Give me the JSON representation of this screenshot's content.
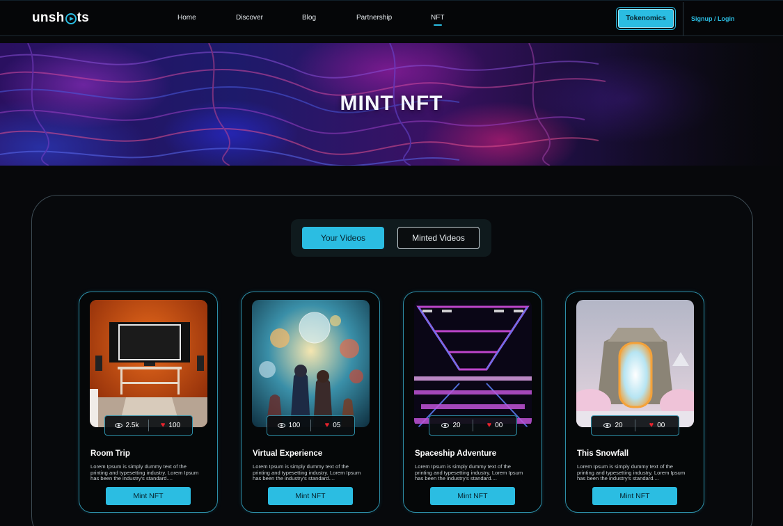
{
  "nav": {
    "logo": {
      "before": "unsh",
      "after": "ts"
    },
    "links": [
      "Home",
      "Discover",
      "Blog",
      "Partnership",
      "NFT"
    ],
    "active_link": "NFT",
    "tokenomics_label": "Tokenomics",
    "login_label": "Signup / Login"
  },
  "hero": {
    "title": "MINT NFT"
  },
  "tabs": {
    "active": "Your Videos",
    "inactive": "Minted Videos"
  },
  "colors": {
    "accent": "#2bbde2",
    "heart": "#e5232d",
    "background": "#07080b"
  },
  "cards": [
    {
      "title": "Room Trip",
      "views": "2.5k",
      "likes": "100",
      "description": "Lorem Ipsum is simply dummy text of the printing and typesetting industry. Lorem Ipsum has been the industry's standard....",
      "button": "Mint NFT"
    },
    {
      "title": "Virtual Experience",
      "views": "100",
      "likes": "05",
      "description": "Lorem Ipsum is simply dummy text of the printing and typesetting industry. Lorem Ipsum has been the industry's standard....",
      "button": "Mint NFT"
    },
    {
      "title": "Spaceship Adventure",
      "views": "20",
      "likes": "00",
      "description": "Lorem Ipsum is simply dummy text of the printing and typesetting industry. Lorem Ipsum has been the industry's standard....",
      "button": "Mint NFT"
    },
    {
      "title": "This Snowfall",
      "views": "20",
      "likes": "00",
      "description": "Lorem Ipsum is simply dummy text of the printing and typesetting industry. Lorem Ipsum has been the industry's standard....",
      "button": "Mint NFT"
    }
  ]
}
